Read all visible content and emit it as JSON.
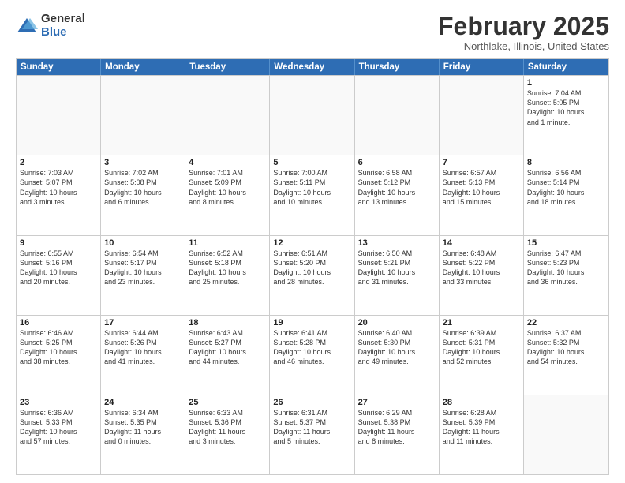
{
  "logo": {
    "general": "General",
    "blue": "Blue"
  },
  "title": "February 2025",
  "location": "Northlake, Illinois, United States",
  "weekdays": [
    "Sunday",
    "Monday",
    "Tuesday",
    "Wednesday",
    "Thursday",
    "Friday",
    "Saturday"
  ],
  "rows": [
    [
      {
        "day": "",
        "text": "",
        "empty": true
      },
      {
        "day": "",
        "text": "",
        "empty": true
      },
      {
        "day": "",
        "text": "",
        "empty": true
      },
      {
        "day": "",
        "text": "",
        "empty": true
      },
      {
        "day": "",
        "text": "",
        "empty": true
      },
      {
        "day": "",
        "text": "",
        "empty": true
      },
      {
        "day": "1",
        "text": "Sunrise: 7:04 AM\nSunset: 5:05 PM\nDaylight: 10 hours\nand 1 minute.",
        "empty": false
      }
    ],
    [
      {
        "day": "2",
        "text": "Sunrise: 7:03 AM\nSunset: 5:07 PM\nDaylight: 10 hours\nand 3 minutes.",
        "empty": false
      },
      {
        "day": "3",
        "text": "Sunrise: 7:02 AM\nSunset: 5:08 PM\nDaylight: 10 hours\nand 6 minutes.",
        "empty": false
      },
      {
        "day": "4",
        "text": "Sunrise: 7:01 AM\nSunset: 5:09 PM\nDaylight: 10 hours\nand 8 minutes.",
        "empty": false
      },
      {
        "day": "5",
        "text": "Sunrise: 7:00 AM\nSunset: 5:11 PM\nDaylight: 10 hours\nand 10 minutes.",
        "empty": false
      },
      {
        "day": "6",
        "text": "Sunrise: 6:58 AM\nSunset: 5:12 PM\nDaylight: 10 hours\nand 13 minutes.",
        "empty": false
      },
      {
        "day": "7",
        "text": "Sunrise: 6:57 AM\nSunset: 5:13 PM\nDaylight: 10 hours\nand 15 minutes.",
        "empty": false
      },
      {
        "day": "8",
        "text": "Sunrise: 6:56 AM\nSunset: 5:14 PM\nDaylight: 10 hours\nand 18 minutes.",
        "empty": false
      }
    ],
    [
      {
        "day": "9",
        "text": "Sunrise: 6:55 AM\nSunset: 5:16 PM\nDaylight: 10 hours\nand 20 minutes.",
        "empty": false
      },
      {
        "day": "10",
        "text": "Sunrise: 6:54 AM\nSunset: 5:17 PM\nDaylight: 10 hours\nand 23 minutes.",
        "empty": false
      },
      {
        "day": "11",
        "text": "Sunrise: 6:52 AM\nSunset: 5:18 PM\nDaylight: 10 hours\nand 25 minutes.",
        "empty": false
      },
      {
        "day": "12",
        "text": "Sunrise: 6:51 AM\nSunset: 5:20 PM\nDaylight: 10 hours\nand 28 minutes.",
        "empty": false
      },
      {
        "day": "13",
        "text": "Sunrise: 6:50 AM\nSunset: 5:21 PM\nDaylight: 10 hours\nand 31 minutes.",
        "empty": false
      },
      {
        "day": "14",
        "text": "Sunrise: 6:48 AM\nSunset: 5:22 PM\nDaylight: 10 hours\nand 33 minutes.",
        "empty": false
      },
      {
        "day": "15",
        "text": "Sunrise: 6:47 AM\nSunset: 5:23 PM\nDaylight: 10 hours\nand 36 minutes.",
        "empty": false
      }
    ],
    [
      {
        "day": "16",
        "text": "Sunrise: 6:46 AM\nSunset: 5:25 PM\nDaylight: 10 hours\nand 38 minutes.",
        "empty": false
      },
      {
        "day": "17",
        "text": "Sunrise: 6:44 AM\nSunset: 5:26 PM\nDaylight: 10 hours\nand 41 minutes.",
        "empty": false
      },
      {
        "day": "18",
        "text": "Sunrise: 6:43 AM\nSunset: 5:27 PM\nDaylight: 10 hours\nand 44 minutes.",
        "empty": false
      },
      {
        "day": "19",
        "text": "Sunrise: 6:41 AM\nSunset: 5:28 PM\nDaylight: 10 hours\nand 46 minutes.",
        "empty": false
      },
      {
        "day": "20",
        "text": "Sunrise: 6:40 AM\nSunset: 5:30 PM\nDaylight: 10 hours\nand 49 minutes.",
        "empty": false
      },
      {
        "day": "21",
        "text": "Sunrise: 6:39 AM\nSunset: 5:31 PM\nDaylight: 10 hours\nand 52 minutes.",
        "empty": false
      },
      {
        "day": "22",
        "text": "Sunrise: 6:37 AM\nSunset: 5:32 PM\nDaylight: 10 hours\nand 54 minutes.",
        "empty": false
      }
    ],
    [
      {
        "day": "23",
        "text": "Sunrise: 6:36 AM\nSunset: 5:33 PM\nDaylight: 10 hours\nand 57 minutes.",
        "empty": false
      },
      {
        "day": "24",
        "text": "Sunrise: 6:34 AM\nSunset: 5:35 PM\nDaylight: 11 hours\nand 0 minutes.",
        "empty": false
      },
      {
        "day": "25",
        "text": "Sunrise: 6:33 AM\nSunset: 5:36 PM\nDaylight: 11 hours\nand 3 minutes.",
        "empty": false
      },
      {
        "day": "26",
        "text": "Sunrise: 6:31 AM\nSunset: 5:37 PM\nDaylight: 11 hours\nand 5 minutes.",
        "empty": false
      },
      {
        "day": "27",
        "text": "Sunrise: 6:29 AM\nSunset: 5:38 PM\nDaylight: 11 hours\nand 8 minutes.",
        "empty": false
      },
      {
        "day": "28",
        "text": "Sunrise: 6:28 AM\nSunset: 5:39 PM\nDaylight: 11 hours\nand 11 minutes.",
        "empty": false
      },
      {
        "day": "",
        "text": "",
        "empty": true
      }
    ]
  ]
}
